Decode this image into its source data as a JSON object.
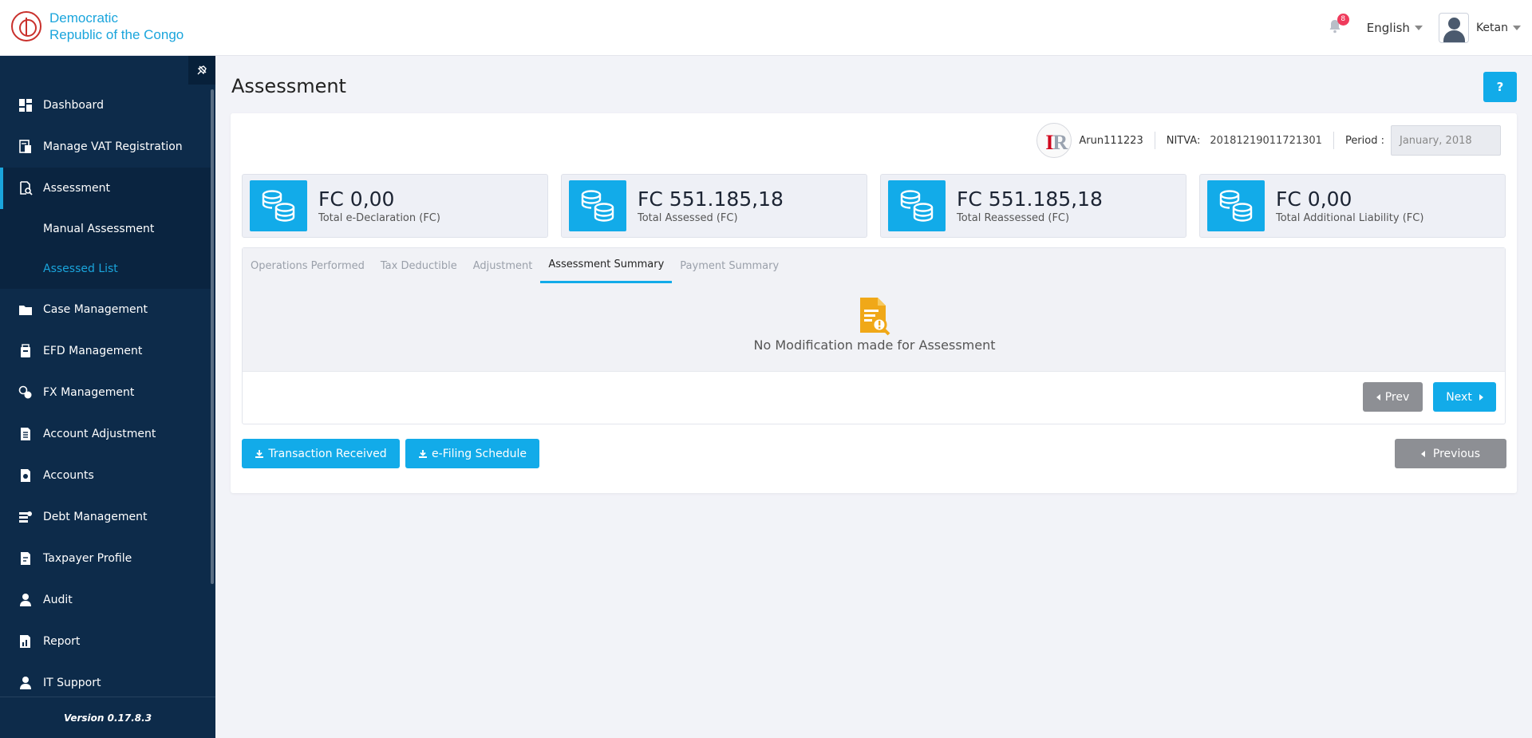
{
  "header": {
    "brand_line1": "Democratic",
    "brand_line2": "Republic of the Congo",
    "notification_count": "8",
    "language": "English",
    "user_name": "Ketan"
  },
  "sidebar": {
    "items": [
      {
        "label": "Dashboard",
        "icon": "dashboard-icon"
      },
      {
        "label": "Manage VAT Registration",
        "icon": "vat-registration-icon"
      },
      {
        "label": "Assessment",
        "icon": "assessment-icon",
        "active": true
      },
      {
        "label": "Case Management",
        "icon": "folder-icon"
      },
      {
        "label": "EFD Management",
        "icon": "efd-device-icon"
      },
      {
        "label": "FX Management",
        "icon": "fx-icon"
      },
      {
        "label": "Account Adjustment",
        "icon": "document-icon"
      },
      {
        "label": "Accounts",
        "icon": "accounts-icon"
      },
      {
        "label": "Debt Management",
        "icon": "debt-icon"
      },
      {
        "label": "Taxpayer Profile",
        "icon": "profile-document-icon"
      },
      {
        "label": "Audit",
        "icon": "user-icon"
      },
      {
        "label": "Report",
        "icon": "report-icon"
      },
      {
        "label": "IT Support",
        "icon": "support-icon"
      }
    ],
    "subitems": [
      {
        "label": "Manual Assessment"
      },
      {
        "label": "Assessed List",
        "current": true
      }
    ],
    "version": "Version 0.17.8.3"
  },
  "main": {
    "title": "Assessment",
    "help_label": "?",
    "taxpayer": {
      "name": "Arun111223",
      "nitva_label": "NITVA:",
      "nitva_value": "20181219011721301",
      "period_label": "Period :",
      "period_value": "January, 2018"
    },
    "stats": [
      {
        "value": "FC 0,00",
        "label": "Total e-Declaration (FC)"
      },
      {
        "value": "FC 551.185,18",
        "label": "Total Assessed (FC)"
      },
      {
        "value": "FC 551.185,18",
        "label": "Total Reassessed (FC)"
      },
      {
        "value": "FC 0,00",
        "label": "Total Additional Liability (FC)"
      }
    ],
    "tabs": [
      {
        "label": "Operations Performed"
      },
      {
        "label": "Tax Deductible"
      },
      {
        "label": "Adjustment"
      },
      {
        "label": "Assessment Summary",
        "active": true
      },
      {
        "label": "Payment Summary"
      }
    ],
    "empty_message": "No Modification made for Assessment",
    "prev_label": "Prev",
    "next_label": "Next",
    "transaction_label": "Transaction Received",
    "efiling_label": "e-Filing Schedule",
    "previous_label": "Previous"
  },
  "colors": {
    "accent": "#12abe9",
    "sidebar_bg": "#0d2b4a",
    "badge": "#ef3b5c",
    "empty_icon": "#f0a818",
    "gray_button": "#8d8f94"
  }
}
